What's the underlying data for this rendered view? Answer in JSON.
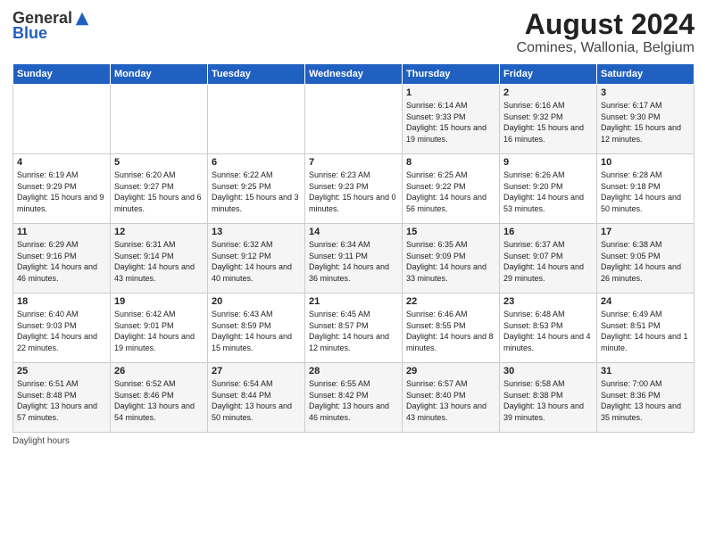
{
  "logo": {
    "general": "General",
    "blue": "Blue"
  },
  "title": "August 2024",
  "subtitle": "Comines, Wallonia, Belgium",
  "days_of_week": [
    "Sunday",
    "Monday",
    "Tuesday",
    "Wednesday",
    "Thursday",
    "Friday",
    "Saturday"
  ],
  "footer": "Daylight hours",
  "weeks": [
    [
      {
        "num": "",
        "sunrise": "",
        "sunset": "",
        "daylight": ""
      },
      {
        "num": "",
        "sunrise": "",
        "sunset": "",
        "daylight": ""
      },
      {
        "num": "",
        "sunrise": "",
        "sunset": "",
        "daylight": ""
      },
      {
        "num": "",
        "sunrise": "",
        "sunset": "",
        "daylight": ""
      },
      {
        "num": "1",
        "sunrise": "Sunrise: 6:14 AM",
        "sunset": "Sunset: 9:33 PM",
        "daylight": "Daylight: 15 hours and 19 minutes."
      },
      {
        "num": "2",
        "sunrise": "Sunrise: 6:16 AM",
        "sunset": "Sunset: 9:32 PM",
        "daylight": "Daylight: 15 hours and 16 minutes."
      },
      {
        "num": "3",
        "sunrise": "Sunrise: 6:17 AM",
        "sunset": "Sunset: 9:30 PM",
        "daylight": "Daylight: 15 hours and 12 minutes."
      }
    ],
    [
      {
        "num": "4",
        "sunrise": "Sunrise: 6:19 AM",
        "sunset": "Sunset: 9:29 PM",
        "daylight": "Daylight: 15 hours and 9 minutes."
      },
      {
        "num": "5",
        "sunrise": "Sunrise: 6:20 AM",
        "sunset": "Sunset: 9:27 PM",
        "daylight": "Daylight: 15 hours and 6 minutes."
      },
      {
        "num": "6",
        "sunrise": "Sunrise: 6:22 AM",
        "sunset": "Sunset: 9:25 PM",
        "daylight": "Daylight: 15 hours and 3 minutes."
      },
      {
        "num": "7",
        "sunrise": "Sunrise: 6:23 AM",
        "sunset": "Sunset: 9:23 PM",
        "daylight": "Daylight: 15 hours and 0 minutes."
      },
      {
        "num": "8",
        "sunrise": "Sunrise: 6:25 AM",
        "sunset": "Sunset: 9:22 PM",
        "daylight": "Daylight: 14 hours and 56 minutes."
      },
      {
        "num": "9",
        "sunrise": "Sunrise: 6:26 AM",
        "sunset": "Sunset: 9:20 PM",
        "daylight": "Daylight: 14 hours and 53 minutes."
      },
      {
        "num": "10",
        "sunrise": "Sunrise: 6:28 AM",
        "sunset": "Sunset: 9:18 PM",
        "daylight": "Daylight: 14 hours and 50 minutes."
      }
    ],
    [
      {
        "num": "11",
        "sunrise": "Sunrise: 6:29 AM",
        "sunset": "Sunset: 9:16 PM",
        "daylight": "Daylight: 14 hours and 46 minutes."
      },
      {
        "num": "12",
        "sunrise": "Sunrise: 6:31 AM",
        "sunset": "Sunset: 9:14 PM",
        "daylight": "Daylight: 14 hours and 43 minutes."
      },
      {
        "num": "13",
        "sunrise": "Sunrise: 6:32 AM",
        "sunset": "Sunset: 9:12 PM",
        "daylight": "Daylight: 14 hours and 40 minutes."
      },
      {
        "num": "14",
        "sunrise": "Sunrise: 6:34 AM",
        "sunset": "Sunset: 9:11 PM",
        "daylight": "Daylight: 14 hours and 36 minutes."
      },
      {
        "num": "15",
        "sunrise": "Sunrise: 6:35 AM",
        "sunset": "Sunset: 9:09 PM",
        "daylight": "Daylight: 14 hours and 33 minutes."
      },
      {
        "num": "16",
        "sunrise": "Sunrise: 6:37 AM",
        "sunset": "Sunset: 9:07 PM",
        "daylight": "Daylight: 14 hours and 29 minutes."
      },
      {
        "num": "17",
        "sunrise": "Sunrise: 6:38 AM",
        "sunset": "Sunset: 9:05 PM",
        "daylight": "Daylight: 14 hours and 26 minutes."
      }
    ],
    [
      {
        "num": "18",
        "sunrise": "Sunrise: 6:40 AM",
        "sunset": "Sunset: 9:03 PM",
        "daylight": "Daylight: 14 hours and 22 minutes."
      },
      {
        "num": "19",
        "sunrise": "Sunrise: 6:42 AM",
        "sunset": "Sunset: 9:01 PM",
        "daylight": "Daylight: 14 hours and 19 minutes."
      },
      {
        "num": "20",
        "sunrise": "Sunrise: 6:43 AM",
        "sunset": "Sunset: 8:59 PM",
        "daylight": "Daylight: 14 hours and 15 minutes."
      },
      {
        "num": "21",
        "sunrise": "Sunrise: 6:45 AM",
        "sunset": "Sunset: 8:57 PM",
        "daylight": "Daylight: 14 hours and 12 minutes."
      },
      {
        "num": "22",
        "sunrise": "Sunrise: 6:46 AM",
        "sunset": "Sunset: 8:55 PM",
        "daylight": "Daylight: 14 hours and 8 minutes."
      },
      {
        "num": "23",
        "sunrise": "Sunrise: 6:48 AM",
        "sunset": "Sunset: 8:53 PM",
        "daylight": "Daylight: 14 hours and 4 minutes."
      },
      {
        "num": "24",
        "sunrise": "Sunrise: 6:49 AM",
        "sunset": "Sunset: 8:51 PM",
        "daylight": "Daylight: 14 hours and 1 minute."
      }
    ],
    [
      {
        "num": "25",
        "sunrise": "Sunrise: 6:51 AM",
        "sunset": "Sunset: 8:48 PM",
        "daylight": "Daylight: 13 hours and 57 minutes."
      },
      {
        "num": "26",
        "sunrise": "Sunrise: 6:52 AM",
        "sunset": "Sunset: 8:46 PM",
        "daylight": "Daylight: 13 hours and 54 minutes."
      },
      {
        "num": "27",
        "sunrise": "Sunrise: 6:54 AM",
        "sunset": "Sunset: 8:44 PM",
        "daylight": "Daylight: 13 hours and 50 minutes."
      },
      {
        "num": "28",
        "sunrise": "Sunrise: 6:55 AM",
        "sunset": "Sunset: 8:42 PM",
        "daylight": "Daylight: 13 hours and 46 minutes."
      },
      {
        "num": "29",
        "sunrise": "Sunrise: 6:57 AM",
        "sunset": "Sunset: 8:40 PM",
        "daylight": "Daylight: 13 hours and 43 minutes."
      },
      {
        "num": "30",
        "sunrise": "Sunrise: 6:58 AM",
        "sunset": "Sunset: 8:38 PM",
        "daylight": "Daylight: 13 hours and 39 minutes."
      },
      {
        "num": "31",
        "sunrise": "Sunrise: 7:00 AM",
        "sunset": "Sunset: 8:36 PM",
        "daylight": "Daylight: 13 hours and 35 minutes."
      }
    ]
  ]
}
